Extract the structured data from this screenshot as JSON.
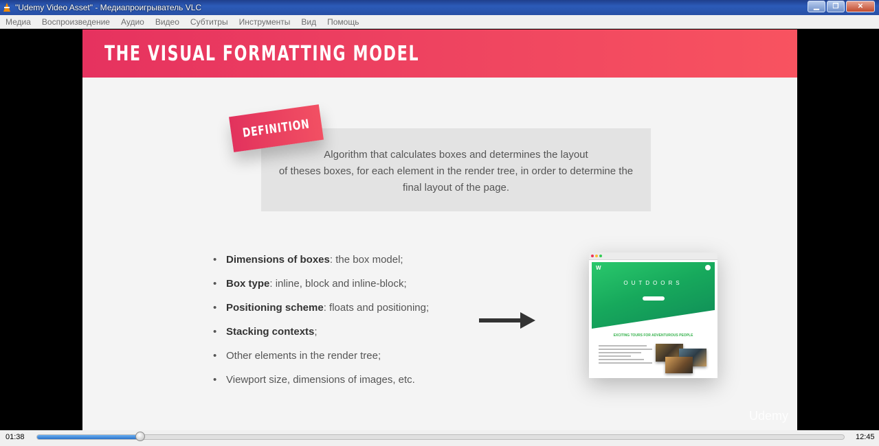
{
  "window": {
    "title": "\"Udemy Video Asset\" - Медиапроигрыватель VLC",
    "buttons": [
      "minimize",
      "restore",
      "close"
    ]
  },
  "menu": {
    "items": [
      "Медиа",
      "Воспроизведение",
      "Аудио",
      "Видео",
      "Субтитры",
      "Инструменты",
      "Вид",
      "Помощь"
    ]
  },
  "slide": {
    "title": "THE VISUAL FORMATTING MODEL",
    "badge": "DEFINITION",
    "definition_lines": [
      "Algorithm that calculates boxes and determines the layout",
      "of theses boxes, for each element in the render tree, in order to determine the",
      "final layout of the page."
    ],
    "bullets": [
      {
        "bold": "Dimensions of boxes",
        "rest": ": the box model;"
      },
      {
        "bold": "Box type",
        "rest": ": inline, block and inline-block;"
      },
      {
        "bold": "Positioning scheme",
        "rest": ": floats and positioning;"
      },
      {
        "bold": "Stacking contexts",
        "rest": ";"
      },
      {
        "bold": "",
        "rest": "Other elements in the render tree;"
      },
      {
        "bold": "",
        "rest": "Viewport size, dimensions of images, etc."
      }
    ],
    "preview": {
      "hero_title": "OUTDOORS",
      "tagline": "EXCITING TOURS FOR ADVENTUROUS PEOPLE"
    },
    "watermark": "Udemy"
  },
  "player": {
    "elapsed": "01:38",
    "total": "12:45",
    "progress_fraction": 0.128
  }
}
